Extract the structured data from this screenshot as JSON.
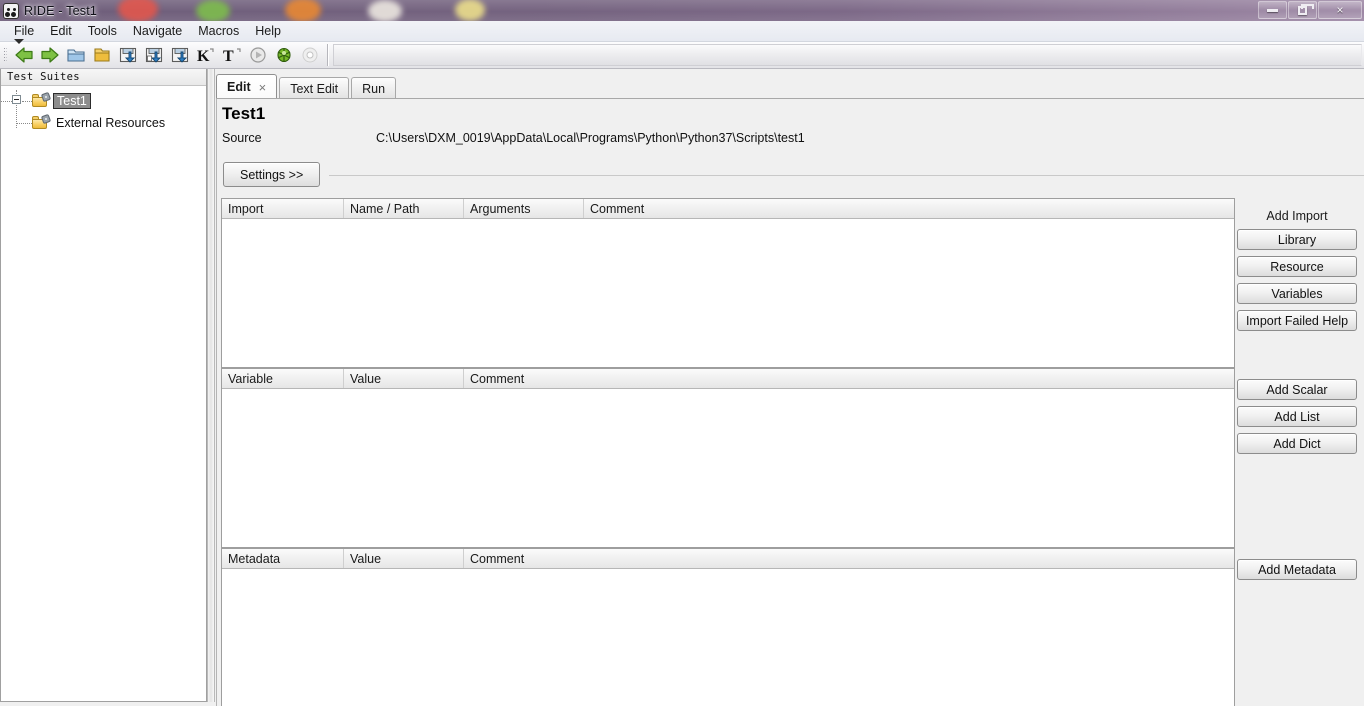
{
  "window": {
    "title": "RIDE - Test1",
    "app_icon": "robot-face-icon",
    "controls": [
      {
        "name": "minimize-button",
        "label": "minimize-icon"
      },
      {
        "name": "restore-button",
        "label": "restore-icon"
      },
      {
        "name": "close-button",
        "label": "×"
      }
    ]
  },
  "menubar": {
    "items": [
      {
        "label": "File"
      },
      {
        "label": "Edit"
      },
      {
        "label": "Tools"
      },
      {
        "label": "Navigate"
      },
      {
        "label": "Macros"
      },
      {
        "label": "Help"
      }
    ]
  },
  "toolbar": {
    "items": [
      {
        "name": "back-icon"
      },
      {
        "name": "forward-icon"
      },
      {
        "name": "open-directory-icon"
      },
      {
        "name": "open-file-icon"
      },
      {
        "name": "save-icon"
      },
      {
        "name": "save-as-icon"
      },
      {
        "name": "save-all-icon"
      },
      {
        "name": "new-keyword-icon"
      },
      {
        "name": "new-test-case-icon"
      },
      {
        "name": "search-keyword-icon"
      },
      {
        "name": "run-icon"
      },
      {
        "name": "stop-icon"
      }
    ]
  },
  "sidebar": {
    "header": "Test Suites",
    "tree": [
      {
        "label": "Test1",
        "icon": "suite-folder-icon",
        "selected": true,
        "expander": "collapse-box"
      },
      {
        "label": "External Resources",
        "icon": "resource-folder-icon",
        "selected": false
      }
    ]
  },
  "editor": {
    "tabs": [
      {
        "label": "Edit",
        "active": true,
        "closable": true,
        "close_glyph": "×"
      },
      {
        "label": "Text Edit",
        "active": false,
        "closable": false
      },
      {
        "label": "Run",
        "active": false,
        "closable": false
      }
    ],
    "suite_title": "Test1",
    "source_label": "Source",
    "source_value": "C:\\Users\\DXM_0019\\AppData\\Local\\Programs\\Python\\Python37\\Scripts\\test1",
    "settings_button": "Settings >>",
    "grids": [
      {
        "name": "imports-grid",
        "columns": [
          "Import",
          "Name / Path",
          "Arguments",
          "Comment"
        ],
        "rows": []
      },
      {
        "name": "variables-grid",
        "columns": [
          "Variable",
          "Value",
          "Comment"
        ],
        "rows": []
      },
      {
        "name": "metadata-grid",
        "columns": [
          "Metadata",
          "Value",
          "Comment"
        ],
        "rows": []
      }
    ],
    "side_panel": {
      "add_import_label": "Add Import",
      "import_buttons": [
        {
          "label": "Library"
        },
        {
          "label": "Resource"
        },
        {
          "label": "Variables"
        },
        {
          "label": "Import Failed Help"
        }
      ],
      "variable_buttons": [
        {
          "label": "Add Scalar"
        },
        {
          "label": "Add List"
        },
        {
          "label": "Add Dict"
        }
      ],
      "metadata_buttons": [
        {
          "label": "Add Metadata"
        }
      ]
    }
  },
  "colors": {
    "titlebar_glass": "#7a6685",
    "selection": "#8d8d8d",
    "panel_bg": "#f0f0f0",
    "grid_bg": "#ffffff",
    "folder_yellow": "#f8cf62"
  }
}
